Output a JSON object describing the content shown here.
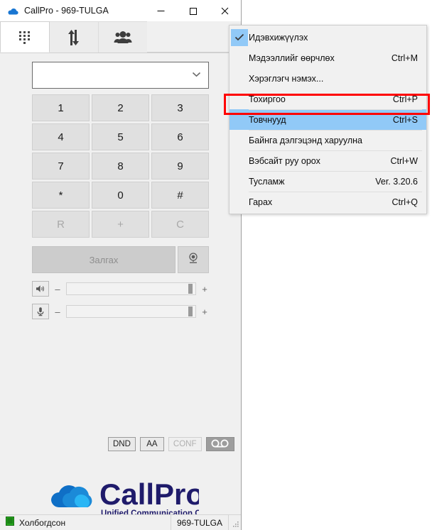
{
  "window": {
    "title": "CallPro - 969-TULGA",
    "icon": "cloud-icon",
    "controls": {
      "minimize": "minimize-icon",
      "maximize": "maximize-icon",
      "close": "close-icon"
    }
  },
  "tabs": [
    {
      "id": "dialpad",
      "icon": "dialpad-icon",
      "active": true
    },
    {
      "id": "history",
      "icon": "call-history-arrows-icon",
      "active": false
    },
    {
      "id": "contacts",
      "icon": "contacts-people-icon",
      "active": false
    }
  ],
  "dialer": {
    "number_input": {
      "value": "",
      "placeholder": ""
    },
    "dropdown_icon": "chevron-down-icon",
    "keys": [
      {
        "label": "1",
        "dim": false
      },
      {
        "label": "2",
        "dim": false
      },
      {
        "label": "3",
        "dim": false
      },
      {
        "label": "4",
        "dim": false
      },
      {
        "label": "5",
        "dim": false
      },
      {
        "label": "6",
        "dim": false
      },
      {
        "label": "7",
        "dim": false
      },
      {
        "label": "8",
        "dim": false
      },
      {
        "label": "9",
        "dim": false
      },
      {
        "label": "*",
        "dim": false
      },
      {
        "label": "0",
        "dim": false
      },
      {
        "label": "#",
        "dim": false
      },
      {
        "label": "R",
        "dim": true
      },
      {
        "label": "+",
        "dim": true
      },
      {
        "label": "C",
        "dim": true
      }
    ],
    "call_button": {
      "label": "Залгах",
      "enabled": false
    },
    "video_button": {
      "icon": "webcam-icon"
    }
  },
  "sliders": {
    "speaker": {
      "icon": "speaker-icon",
      "minus": "–",
      "plus": "+",
      "value": 97
    },
    "microphone": {
      "icon": "microphone-icon",
      "minus": "–",
      "plus": "+",
      "value": 97
    }
  },
  "toggles": [
    {
      "label": "DND",
      "state": "on"
    },
    {
      "label": "AA",
      "state": "on"
    },
    {
      "label": "CONF",
      "state": "disabled"
    },
    {
      "label": "",
      "icon": "voicemail-icon",
      "state": "active"
    }
  ],
  "logo": {
    "name": "CallPro",
    "tagline": "Unified Communication Company",
    "text_color": "#1f1b6b",
    "cloud_colors": [
      "#0f6fc6",
      "#1682d4",
      "#29b6f6"
    ]
  },
  "statusbar": {
    "status_icon": "connected-icon",
    "status_text": "Холбогдсон",
    "extension": "969-TULGA",
    "grip_icon": "resize-grip-icon"
  },
  "menu": {
    "highlight_color": "#91c9f7",
    "callout_color": "#ff0000",
    "items": [
      {
        "label": "Идэвхижүүлэх",
        "accel": "",
        "checked": true,
        "highlighted": false,
        "separator": false
      },
      {
        "label": "Мэдээллийг өөрчлөх",
        "accel": "Ctrl+M",
        "checked": false,
        "highlighted": false,
        "separator": false
      },
      {
        "label": "Хэрэглэгч нэмэх...",
        "accel": "",
        "checked": false,
        "highlighted": false,
        "separator": false
      },
      {
        "label": "Тохиргоо",
        "accel": "Ctrl+P",
        "checked": false,
        "highlighted": false,
        "separator": false
      },
      {
        "label": "Товчнууд",
        "accel": "Ctrl+S",
        "checked": false,
        "highlighted": true,
        "separator": true
      },
      {
        "label": "Байнга дэлгэцэнд харуулна",
        "accel": "",
        "checked": false,
        "highlighted": false,
        "separator": true
      },
      {
        "label": "Вэбсайт руу орох",
        "accel": "Ctrl+W",
        "checked": false,
        "highlighted": false,
        "separator": true
      },
      {
        "label": "Тусламж",
        "accel": "Ver. 3.20.6",
        "checked": false,
        "highlighted": false,
        "separator": true
      },
      {
        "label": "Гарах",
        "accel": "Ctrl+Q",
        "checked": false,
        "highlighted": false,
        "separator": true
      }
    ]
  }
}
